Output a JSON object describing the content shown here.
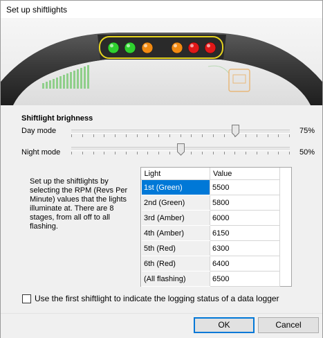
{
  "window": {
    "title": "Set up shiftlights"
  },
  "dashboard": {
    "lights": [
      {
        "color": "#2fd12f"
      },
      {
        "color": "#2fd12f"
      },
      {
        "color": "#f18a12"
      },
      {
        "color": "#f18a12"
      },
      {
        "color": "#e01818"
      },
      {
        "color": "#e01818"
      }
    ],
    "highlight_color": "#e6d41f"
  },
  "brightness": {
    "title": "Shiftlight brighness",
    "day": {
      "label": "Day mode",
      "value_text": "75%",
      "level": 0.75
    },
    "night": {
      "label": "Night mode",
      "value_text": "50%",
      "level": 0.5
    }
  },
  "description": "Set up the shiftlights by selecting the RPM (Revs Per Minute) values that the lights illuminate at. There are 8 stages, from all off to all flashing.",
  "table": {
    "headers": {
      "light": "Light",
      "value": "Value"
    },
    "rows": [
      {
        "light": "1st (Green)",
        "value": "5500",
        "selected": true
      },
      {
        "light": "2nd (Green)",
        "value": "5800"
      },
      {
        "light": "3rd (Amber)",
        "value": "6000"
      },
      {
        "light": "4th (Amber)",
        "value": "6150"
      },
      {
        "light": "5th (Red)",
        "value": "6300"
      },
      {
        "light": "6th (Red)",
        "value": "6400"
      },
      {
        "light": "(All flashing)",
        "value": "6500"
      }
    ]
  },
  "logging_checkbox": {
    "label": "Use the first shiftlight to indicate the logging status of a data logger",
    "checked": false
  },
  "buttons": {
    "ok": "OK",
    "cancel": "Cancel"
  }
}
